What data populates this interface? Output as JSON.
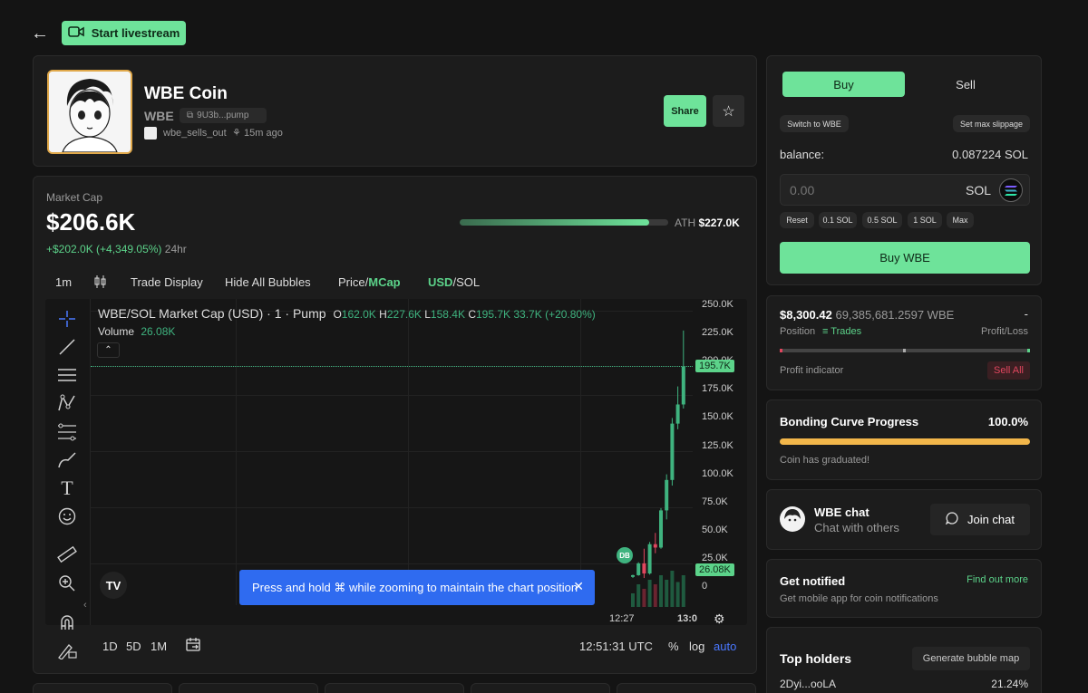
{
  "topbar": {
    "livestream_label": "Start livestream"
  },
  "coin": {
    "name": "WBE Coin",
    "ticker": "WBE",
    "address": "9U3b...pump",
    "creator": "wbe_sells_out",
    "age": "15m ago",
    "share_label": "Share"
  },
  "market": {
    "label": "Market Cap",
    "value": "$206.6K",
    "change": "+$202.0K (+4,349.05%)",
    "period": "24hr",
    "ath_label": "ATH",
    "ath_value": "$227.0K",
    "ath_progress": 0.91
  },
  "chart_toolbar": {
    "interval": "1m",
    "trade_display": "Trade Display",
    "hide_bubbles": "Hide All Bubbles",
    "price_label": "Price/",
    "mcap_label": "MCap",
    "usd_label": "USD",
    "sol_label": "/SOL"
  },
  "chart_legend": {
    "title": "WBE/SOL Market Cap (USD) · 1 · Pump",
    "o_label": "O",
    "o": "162.0K",
    "h_label": "H",
    "h": "227.6K",
    "l_label": "L",
    "l": "158.4K",
    "c_label": "C",
    "c": "195.7K",
    "change": "33.7K (+20.80%)",
    "volume_label": "Volume",
    "volume": "26.08K"
  },
  "chart_data": {
    "type": "candlestick",
    "y_ticks": [
      "250.0K",
      "225.0K",
      "200.0K",
      "175.0K",
      "150.0K",
      "125.0K",
      "100.0K",
      "75.0K",
      "50.0K",
      "25.0K",
      "0"
    ],
    "ylim": [
      0,
      250000
    ],
    "x_ticks": [
      "12:27",
      "13:0"
    ],
    "last_price_label": "195.7K",
    "volume_label": "26.08K",
    "candles": [
      {
        "o": 9000,
        "h": 11000,
        "l": 8000,
        "c": 10500
      },
      {
        "o": 10500,
        "h": 22000,
        "l": 10000,
        "c": 21000
      },
      {
        "o": 21000,
        "h": 34000,
        "l": 8000,
        "c": 12000
      },
      {
        "o": 12000,
        "h": 40000,
        "l": 11000,
        "c": 38000
      },
      {
        "o": 38000,
        "h": 48000,
        "l": 30000,
        "c": 35000
      },
      {
        "o": 35000,
        "h": 70000,
        "l": 34000,
        "c": 68000
      },
      {
        "o": 68000,
        "h": 100000,
        "l": 60000,
        "c": 95000
      },
      {
        "o": 95000,
        "h": 150000,
        "l": 90000,
        "c": 145000
      },
      {
        "o": 145000,
        "h": 178000,
        "l": 140000,
        "c": 162000
      },
      {
        "o": 162000,
        "h": 227600,
        "l": 158400,
        "c": 195700
      }
    ],
    "volumes": [
      0.3,
      0.5,
      0.4,
      0.6,
      0.5,
      0.7,
      0.6,
      0.8,
      0.55,
      0.7
    ],
    "marker": "DB"
  },
  "chart_bottom": {
    "range_1d": "1D",
    "range_5d": "5D",
    "range_1m": "1M",
    "time": "12:51:31 UTC",
    "percent": "%",
    "log": "log",
    "auto": "auto"
  },
  "toast": {
    "text": "Press and hold ⌘ while zooming to maintain the chart position"
  },
  "trade": {
    "buy_tab": "Buy",
    "sell_tab": "Sell",
    "switch_label": "Switch to WBE",
    "slippage_label": "Set max slippage",
    "balance_label": "balance:",
    "balance_value": "0.087224 SOL",
    "amount_placeholder": "0.00",
    "currency": "SOL",
    "quick": [
      "Reset",
      "0.1 SOL",
      "0.5 SOL",
      "1 SOL",
      "Max"
    ],
    "submit_label": "Buy WBE"
  },
  "position": {
    "value": "$8,300.42",
    "amount": "69,385,681.2597 WBE",
    "dash": "-",
    "position_label": "Position",
    "trades_label": "Trades",
    "pl_label": "Profit/Loss",
    "indicator_label": "Profit indicator",
    "sell_all": "Sell All"
  },
  "bonding": {
    "title": "Bonding Curve Progress",
    "percent": "100.0%",
    "progress": 1.0,
    "status": "Coin has graduated!"
  },
  "chat": {
    "title": "WBE chat",
    "subtitle": "Chat with others",
    "join_label": "Join chat"
  },
  "notify": {
    "title": "Get notified",
    "link": "Find out more",
    "subtitle": "Get mobile app for coin notifications"
  },
  "holders": {
    "title": "Top holders",
    "bubble_map": "Generate bubble map",
    "rows": [
      {
        "address": "2Dyi...ooLA",
        "percent": "21.24%"
      }
    ]
  },
  "colors": {
    "accent": "#6ee39a",
    "up": "#3fb37f",
    "down": "#e0465e",
    "toast": "#2f6bf0"
  }
}
